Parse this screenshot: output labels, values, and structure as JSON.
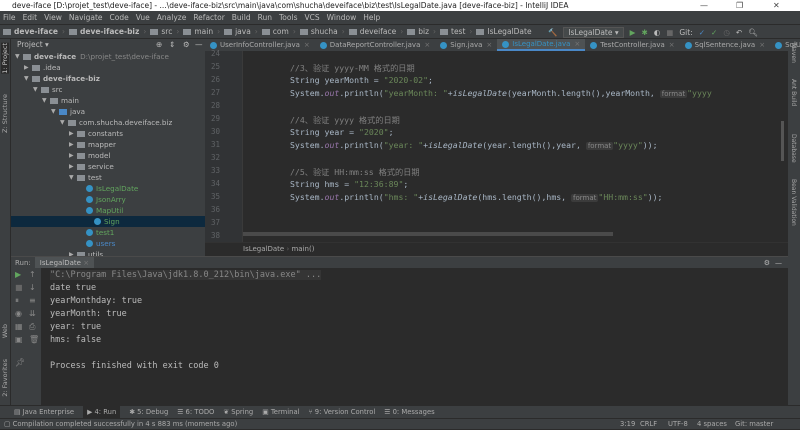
{
  "window": {
    "title": "deve-iface [D:\\projet_test\\deve-iface] - ...\\deve-iface-biz\\src\\main\\java\\com\\shucha\\deveiface\\biz\\test\\IsLegalDate.java [deve-iface-biz] - IntelliJ IDEA",
    "minimize": "—",
    "maximize": "❐",
    "close": "✕"
  },
  "menu": [
    "File",
    "Edit",
    "View",
    "Navigate",
    "Code",
    "Vue",
    "Analyze",
    "Refactor",
    "Build",
    "Run",
    "Tools",
    "VCS",
    "Window",
    "Help"
  ],
  "breadcrumbs": [
    "deve-iface",
    "deve-iface-biz",
    "src",
    "main",
    "java",
    "com",
    "shucha",
    "deveiface",
    "biz",
    "test",
    "IsLegalDate"
  ],
  "toolbar": {
    "run_config": "IsLegalDate",
    "git_label": "Git:"
  },
  "project": {
    "header": "Project",
    "tree": [
      {
        "label": "deve-iface",
        "extra": "D:\\projet_test\\deve-iface",
        "level": 0,
        "open": true,
        "bold": true
      },
      {
        "label": ".idea",
        "level": 1,
        "open": false
      },
      {
        "label": "deve-iface-biz",
        "level": 1,
        "open": true,
        "bold": true
      },
      {
        "label": "src",
        "level": 2,
        "open": true
      },
      {
        "label": "main",
        "level": 3,
        "open": true
      },
      {
        "label": "java",
        "level": 4,
        "open": true
      },
      {
        "label": "com.shucha.deveiface.biz",
        "level": 5,
        "open": true
      },
      {
        "label": "constants",
        "level": 6,
        "open": false
      },
      {
        "label": "mapper",
        "level": 6,
        "open": false
      },
      {
        "label": "model",
        "level": 6,
        "open": false
      },
      {
        "label": "service",
        "level": 6,
        "open": false
      },
      {
        "label": "test",
        "level": 6,
        "open": true
      },
      {
        "label": "IsLegalDate",
        "level": 7,
        "cls": true
      },
      {
        "label": "JsonArry",
        "level": 7,
        "cls": true
      },
      {
        "label": "MapUtil",
        "level": 7,
        "cls": true
      },
      {
        "label": "Sign",
        "level": 7,
        "cls": true,
        "selected": true
      },
      {
        "label": "test1",
        "level": 7,
        "cls": true
      },
      {
        "label": "users",
        "level": 7,
        "cls": true
      },
      {
        "label": "utils",
        "level": 6,
        "open": false
      }
    ]
  },
  "tabs": [
    {
      "label": "UserInfoController.java"
    },
    {
      "label": "DataReportController.java"
    },
    {
      "label": "Sign.java"
    },
    {
      "label": "IsLegalDate.java",
      "active": true
    },
    {
      "label": "TestController.java"
    },
    {
      "label": "SqlSentence.java"
    },
    {
      "label": "SqlUtil.java"
    }
  ],
  "editor": {
    "line_numbers": [
      "24",
      "25",
      "26",
      "27",
      "28",
      "29",
      "30",
      "31",
      "32",
      "33",
      "34",
      "35",
      "36",
      "37",
      "38"
    ],
    "code": {
      "l25": "//3、验证 yyyy-MM 格式的日期",
      "l26a": "String yearMonth = ",
      "l26b": "\"2020-02\"",
      "l26c": ";",
      "l27a": "System.",
      "l27b": "out",
      "l27c": ".println(",
      "l27d": "\"yearMonth: \"",
      "l27e": "+",
      "l27f": "isLegalDate",
      "l27g": "(yearMonth.length(),yearMonth, ",
      "l27h": "\"yyyy",
      "l29": "//4、验证 yyyy 格式的日期",
      "l30a": "String year = ",
      "l30b": "\"2020\"",
      "l30c": ";",
      "l31a": "System.",
      "l31b": "out",
      "l31c": ".println(",
      "l31d": "\"year: \"",
      "l31e": "+",
      "l31f": "isLegalDate",
      "l31g": "(year.length(),year, ",
      "l31h": "\"yyyy\"",
      "l31i": "));",
      "l33": "//5、验证 HH:mm:ss 格式的日期",
      "l34a": "String hms = ",
      "l34b": "\"12:36:89\"",
      "l34c": ";",
      "l35a": "System.",
      "l35b": "out",
      "l35c": ".println(",
      "l35d": "\"hms: \"",
      "l35e": "+",
      "l35f": "isLegalDate",
      "l35g": "(hms.length(),hms, ",
      "l35h": "\"HH:mm:ss\"",
      "l35i": "));",
      "hint": "format"
    },
    "crumb": [
      "IsLegalDate",
      "main()"
    ]
  },
  "run": {
    "label": "Run:",
    "tab": "IsLegalDate",
    "output": [
      "\"C:\\Program Files\\Java\\jdk1.8.0_212\\bin\\java.exe\" ...",
      "date true",
      "yearMonthday: true",
      "yearMonth: true",
      "year: true",
      "hms: false",
      "",
      "Process finished with exit code 0"
    ]
  },
  "left_stripe": [
    "1: Project",
    "Z: Structure",
    "Web",
    "2: Favorites"
  ],
  "right_stripe": [
    "Maven",
    "Ant Build",
    "Database",
    "Bean Validation"
  ],
  "bottom_tabs": [
    "Java Enterprise",
    "4: Run",
    "5: Debug",
    "6: TODO",
    "Spring",
    "Terminal",
    "9: Version Control",
    "0: Messages"
  ],
  "status": {
    "message": "Compilation completed successfully in 4 s 883 ms (moments ago)",
    "position": "3:19",
    "line_sep": "CRLF",
    "encoding": "UTF-8",
    "indent": "4 spaces",
    "vcs": "Git: master"
  }
}
